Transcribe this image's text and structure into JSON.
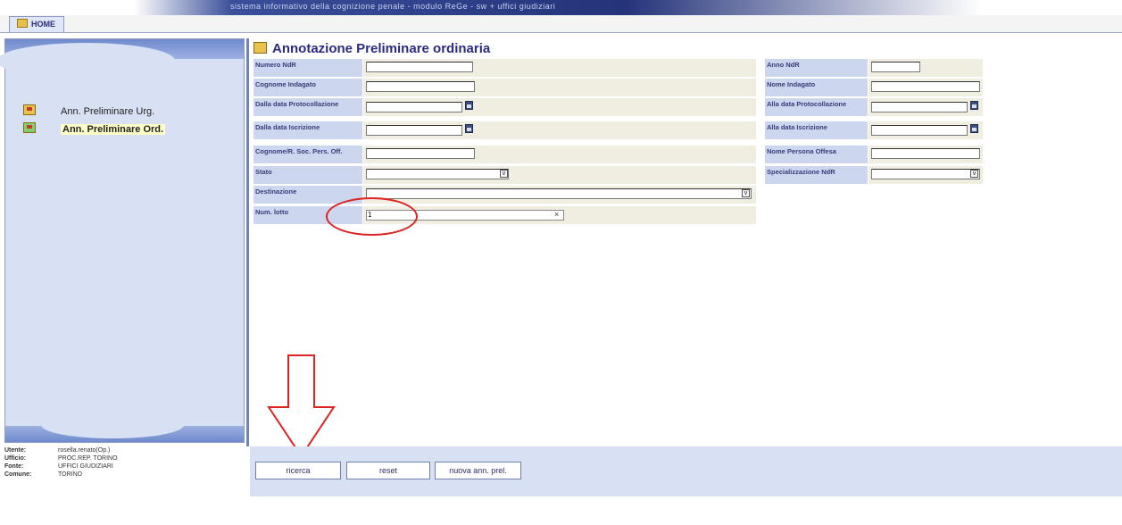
{
  "banner": {
    "text": "sistema informativo della cognizione penale - modulo ReGe - sw + uffici giudiziari"
  },
  "home_tab": {
    "label": "HOME"
  },
  "sidebar": {
    "items": [
      {
        "label": "Ann. Preliminare Urg.",
        "active": false
      },
      {
        "label": "Ann. Preliminare Ord.",
        "active": true
      }
    ]
  },
  "user_info": [
    {
      "key": "Utente:",
      "value": "rosella.renato(Op.)"
    },
    {
      "key": "Ufficio:",
      "value": "PROC.REP. TORINO"
    },
    {
      "key": "Fonte:",
      "value": "UFFICI GIUDIZIARI"
    },
    {
      "key": "Comune:",
      "value": "TORINO"
    }
  ],
  "page": {
    "title": "Annotazione Preliminare ordinaria"
  },
  "form": {
    "numero_ndr": {
      "label": "Numero NdR",
      "value": ""
    },
    "anno_ndr": {
      "label": "Anno NdR",
      "value": ""
    },
    "cognome_indagato": {
      "label": "Cognome Indagato",
      "value": ""
    },
    "nome_indagato": {
      "label": "Nome Indagato",
      "value": ""
    },
    "dalla_data_protocollazione": {
      "label": "Dalla data Protocollazione",
      "value": ""
    },
    "alla_data_protocollazione": {
      "label": "Alla data Protocollazione",
      "value": ""
    },
    "dalla_data_iscrizione": {
      "label": "Dalla data Iscrizione",
      "value": ""
    },
    "alla_data_iscrizione": {
      "label": "Alla data Iscrizione",
      "value": ""
    },
    "cognome_persona_offesa": {
      "label": "Cognome/R. Soc. Pers. Off.",
      "value": ""
    },
    "nome_persona_offesa": {
      "label": "Nome Persona Offesa",
      "value": ""
    },
    "stato": {
      "label": "Stato",
      "value": ""
    },
    "specializzazione_ndr": {
      "label": "Specializzazione NdR",
      "value": ""
    },
    "destinazione": {
      "label": "Destinazione",
      "value": ""
    },
    "num_lotto": {
      "label": "Num. lotto",
      "value": "1"
    }
  },
  "buttons": {
    "search": "ricerca",
    "reset": "reset",
    "new": "nuova ann. prel."
  },
  "icons": {
    "calendar": "calendar-icon",
    "dropdown": "chevron-down-icon",
    "clear": "clear-icon",
    "folder": "folder-icon"
  },
  "colors": {
    "annotation": "#dd2222",
    "title": "#2b2b80"
  }
}
